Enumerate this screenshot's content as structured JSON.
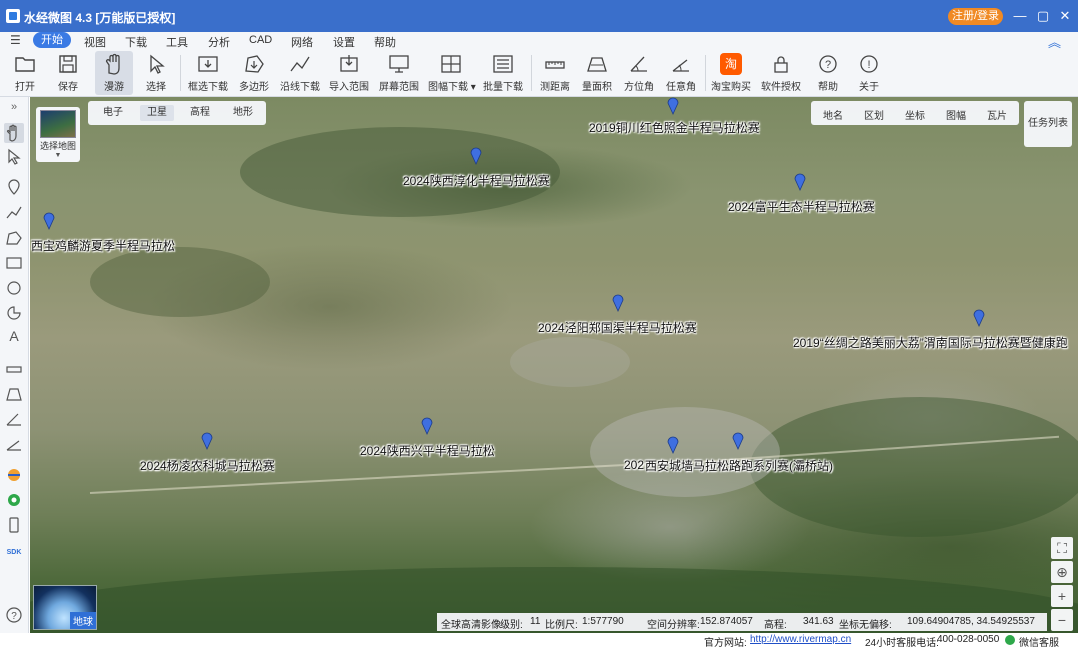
{
  "window": {
    "title": "水经微图 4.3 [万能版已授权]",
    "login_button": "注册/登录"
  },
  "menu": {
    "items": [
      "开始",
      "视图",
      "下载",
      "工具",
      "分析",
      "CAD",
      "网络",
      "设置",
      "帮助"
    ],
    "active": "开始"
  },
  "toolbar": {
    "items": [
      "打开",
      "保存",
      "漫游",
      "选择",
      "框选下载",
      "多边形",
      "沿线下载",
      "导入范围",
      "屏幕范围",
      "图幅下载",
      "批量下载",
      "测距离",
      "量面积",
      "方位角",
      "任意角",
      "淘宝购买",
      "软件授权",
      "帮助",
      "关于"
    ],
    "active": "漫游"
  },
  "map_types": {
    "items": [
      "电子",
      "卫星",
      "高程",
      "地形"
    ],
    "active": "卫星"
  },
  "layer_toggles": [
    "地名",
    "区划",
    "坐标",
    "图幅",
    "瓦片"
  ],
  "task_list": "任务列表",
  "basemap_picker": "选择地图",
  "globe_label": "地球",
  "markers": [
    {
      "label": "2019铜川红色照金半程马拉松赛"
    },
    {
      "label": "2024陕西淳化半程马拉松赛"
    },
    {
      "label": "2024富平生态半程马拉松赛"
    },
    {
      "label": "西宝鸡麟游夏季半程马拉松"
    },
    {
      "label": "2024泾阳郑国渠半程马拉松赛"
    },
    {
      "label": "2019“丝绸之路美丽大荔”渭南国际马拉松赛暨健康跑"
    },
    {
      "label": "2024杨凌农科城马拉松赛"
    },
    {
      "label": "2024陕西兴平半程马拉松"
    },
    {
      "label": "202"
    },
    {
      "label": "西安城墙马拉松路跑系列赛(灞桥站)"
    }
  ],
  "info_bar": {
    "source": "全球高清影像",
    "level_label": "级别:",
    "level": "11",
    "scale_label": "比例尺:",
    "scale": "1:577790",
    "resolution_label": "空间分辨率:",
    "resolution": "152.874057",
    "elevation_label": "高程:",
    "elevation": "341.63",
    "coord_label": "坐标无偏移:",
    "coords": "109.64904785, 34.54925537"
  },
  "status_bar": {
    "website_label": "官方网站:",
    "website": "http://www.rivermap.cn",
    "hotline_label": "24小时客服电话:",
    "hotline": "400-028-0050",
    "wechat": "微信客服"
  },
  "colors": {
    "title_bar": "#3a6fcb",
    "accent": "#3a7ae4",
    "login": "#f08a24",
    "marker": "#3f6fe0"
  }
}
